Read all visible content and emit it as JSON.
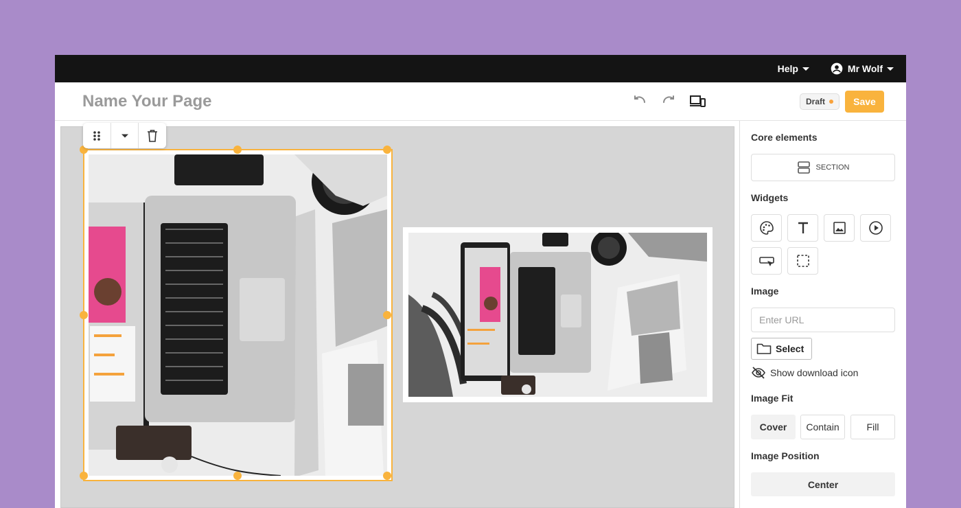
{
  "topbar": {
    "help_label": "Help",
    "user_name": "Mr Wolf"
  },
  "header": {
    "page_name": "Name Your Page",
    "status": "Draft",
    "save_label": "Save",
    "status_dot_color": "#f9a23c",
    "accent_color": "#f9b33d"
  },
  "toolbar": {
    "icons": [
      "drag-handle-icon",
      "chevron-down-icon",
      "trash-icon"
    ]
  },
  "panel": {
    "core_title": "Core elements",
    "section_label": "SECTION",
    "widgets_title": "Widgets",
    "widgets": [
      "palette-icon",
      "text-icon",
      "image-icon",
      "play-icon",
      "button-icon",
      "container-icon"
    ],
    "image_title": "Image",
    "url_placeholder": "Enter URL",
    "select_label": "Select",
    "download_label": "Show download icon",
    "fit_title": "Image Fit",
    "fit_options": [
      "Cover",
      "Contain",
      "Fill"
    ],
    "fit_selected": "Cover",
    "position_title": "Image Position",
    "position_value": "Center"
  }
}
